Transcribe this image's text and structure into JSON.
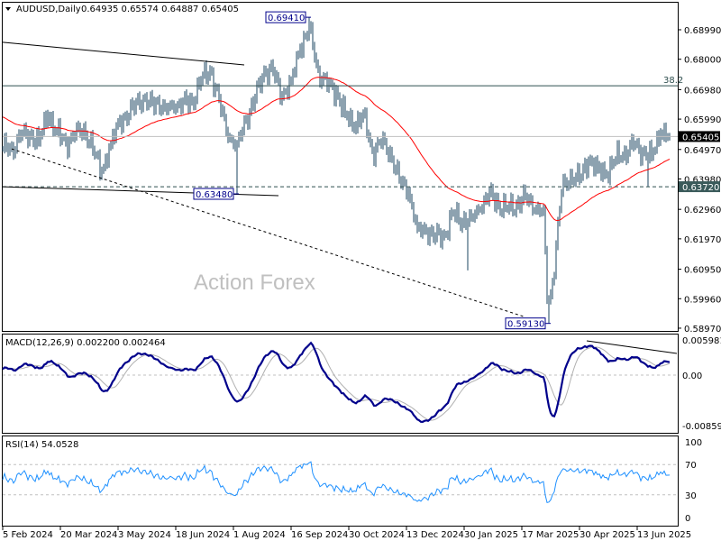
{
  "header": {
    "symbol": "AUDUSD,Daily",
    "ohlc": "0.64935 0.65574 0.64887 0.65405"
  },
  "watermark": "Action Forex",
  "colors": {
    "bars": "#1b4460",
    "ma": "#ff0000",
    "macd": "#00008b",
    "signal": "#b0b0b0",
    "rsi": "#1e90ff",
    "fib": "#2f4f4f",
    "label_border": "#00008b"
  },
  "chart_data": [
    {
      "type": "bar",
      "title": "AUDUSD,Daily",
      "price_axis_ticks": [
        "0.68990",
        "0.68000",
        "0.66980",
        "0.65990",
        "0.64970",
        "0.63980",
        "0.62960",
        "0.61970",
        "0.60950",
        "0.59960",
        "0.58970"
      ],
      "ylim": [
        0.5897,
        0.6999
      ],
      "date_ticks": [
        "5 Feb 2024",
        "20 Mar 2024",
        "3 May 2024",
        "18 Jun 2024",
        "1 Aug 2024",
        "16 Sep 2024",
        "30 Oct 2024",
        "13 Dec 2024",
        "30 Jan 2025",
        "17 Mar 2025",
        "30 Apr 2025",
        "13 Jun 2025"
      ],
      "bars_per_date_tick": 32,
      "close_keypoints_every_5_bars": [
        0.6499,
        0.6505,
        0.6536,
        0.6551,
        0.6524,
        0.6614,
        0.6554,
        0.6524,
        0.6536,
        0.6575,
        0.6493,
        0.6424,
        0.6515,
        0.6596,
        0.6605,
        0.6675,
        0.6645,
        0.6657,
        0.6636,
        0.6636,
        0.6657,
        0.6657,
        0.6726,
        0.6766,
        0.6666,
        0.6536,
        0.6515,
        0.6596,
        0.6666,
        0.6766,
        0.6757,
        0.6675,
        0.6726,
        0.6838,
        0.6899,
        0.6766,
        0.6705,
        0.6696,
        0.6614,
        0.6575,
        0.6614,
        0.6493,
        0.6515,
        0.6493,
        0.6393,
        0.6354,
        0.6233,
        0.6221,
        0.6203,
        0.6212,
        0.6281,
        0.6251,
        0.6272,
        0.6294,
        0.6354,
        0.6312,
        0.6294,
        0.6312,
        0.6342,
        0.6294,
        0.6294,
        0.605,
        0.6354,
        0.6415,
        0.6393,
        0.6463,
        0.6433,
        0.6415,
        0.6463,
        0.6493,
        0.6505,
        0.6493,
        0.6475,
        0.6554,
        0.65405
      ],
      "extra_keypoints": [
        [
          302,
          0.599
        ],
        [
          304,
          0.601
        ]
      ],
      "wicks": [
        {
          "bar": 170,
          "high": 0.6941
        },
        {
          "bar": 130,
          "low": 0.6348
        },
        {
          "bar": 303,
          "low": 0.5913
        },
        {
          "bar": 258,
          "low": 0.6091
        },
        {
          "bar": 358,
          "low": 0.6372
        }
      ],
      "moving_average": {
        "type": "EMA",
        "period": 55,
        "seed": 0.661
      },
      "current_price": "0.65405",
      "level_price": "0.63720",
      "fib_level": {
        "label": "38.2",
        "price": 0.6711
      },
      "annotations": [
        {
          "text": "0.69410",
          "price": 0.6941,
          "bar": 170
        },
        {
          "text": "0.63480",
          "price": 0.6348,
          "bar": 130
        },
        {
          "text": "0.59130",
          "price": 0.5913,
          "bar": 303
        }
      ],
      "trendlines": [
        {
          "from": [
            0,
            0.6857
          ],
          "to": [
            134,
            0.6781
          ],
          "style": "solid"
        },
        {
          "from": [
            0,
            0.6372
          ],
          "to": [
            153,
            0.6342
          ],
          "style": "solid"
        },
        {
          "from": [
            5,
            0.6499
          ],
          "to": [
            290,
            0.5934
          ],
          "style": "dotted"
        }
      ]
    },
    {
      "type": "line",
      "title": "MACD(12,26,9) 0.002200 0.002464",
      "params": [
        12,
        26,
        9
      ],
      "ticks": [
        "0.005981",
        "0.00",
        "-0.00859"
      ],
      "ylim": [
        -0.00859,
        0.005981
      ],
      "trendline": {
        "from": [
          324,
          0.00583
        ],
        "to": [
          374,
          0.00368
        ]
      }
    },
    {
      "type": "line",
      "title": "RSI(14) 54.0528",
      "period": 14,
      "ticks": [
        "100",
        "70",
        "30",
        "0"
      ],
      "levels": [
        70,
        30
      ],
      "ylim": [
        0,
        100
      ]
    }
  ]
}
